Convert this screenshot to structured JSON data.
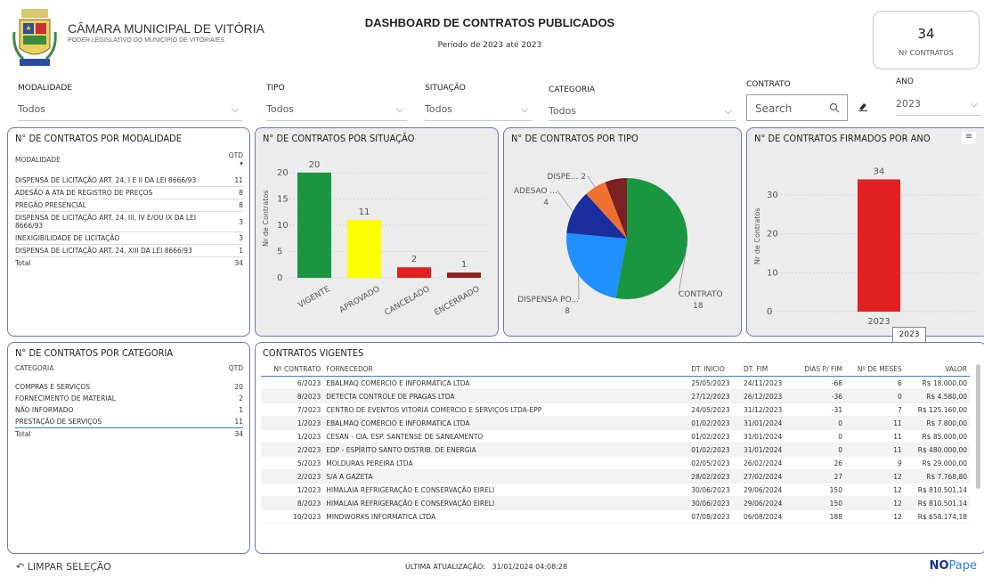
{
  "header": {
    "org_name": "CÂMARA MUNICIPAL DE VITÓRIA",
    "org_sub": "PODER LEGISLATIVO DO MUNICÍPIO DE VITÓRIA/ES",
    "title": "DASHBOARD DE CONTRATOS PUBLICADOS",
    "period": "Período de 2023 até 2023",
    "count_value": "34",
    "count_label": "Nº CONTRATOS"
  },
  "filters": {
    "modalidade": {
      "label": "MODALIDADE",
      "value": "Todos"
    },
    "tipo": {
      "label": "TIPO",
      "value": "Todos"
    },
    "situacao": {
      "label": "SITUAÇÃO",
      "value": "Todos"
    },
    "categoria": {
      "label": "CATEGORIA",
      "value": "Todos"
    },
    "contrato": {
      "label": "CONTRATO",
      "placeholder": "Search"
    },
    "ano": {
      "label": "ANO",
      "value": "2023"
    }
  },
  "modalidade_panel": {
    "title": "N° DE CONTRATOS POR MODALIDADE",
    "col1": "MODALIDADE",
    "col2": "QTD",
    "rows": [
      {
        "name": "DISPENSA DE LICITAÇÃO ART. 24, I E II DA LEI 8666/93",
        "qtd": "11"
      },
      {
        "name": "ADESÃO A ATA DE REGISTRO DE PREÇOS",
        "qtd": "8"
      },
      {
        "name": "PREGÃO PRESENCIAL",
        "qtd": "8"
      },
      {
        "name": "DISPENSA DE LICITAÇÃO ART. 24, III, IV E/OU IX DA LEI 8666/93",
        "qtd": "3"
      },
      {
        "name": "INEXIGIBILIDADE DE LICITAÇÃO",
        "qtd": "3"
      },
      {
        "name": "DISPENSA DE LICITAÇÃO ART. 24, XIII DA LEI 8666/93",
        "qtd": "1"
      }
    ],
    "total_label": "Total",
    "total_value": "34"
  },
  "situacao_panel": {
    "title": "N° DE CONTRATOS POR SITUAÇÃO"
  },
  "tipo_panel": {
    "title": "N° DE CONTRATOS POR TIPO"
  },
  "ano_panel": {
    "title": "N° DE CONTRATOS FIRMADOS POR ANO",
    "tooltip": "2023"
  },
  "categoria_panel": {
    "title": "N° DE CONTRATOS POR CATEGORIA",
    "col1": "CATEGORIA",
    "col2": "QTD",
    "rows": [
      {
        "name": "COMPRAS E SERVIÇOS",
        "qtd": "20"
      },
      {
        "name": "FORNECIMENTO DE MATERIAL",
        "qtd": "2"
      },
      {
        "name": "NÃO INFORMADO",
        "qtd": "1"
      },
      {
        "name": "PRESTAÇÃO DE SERVIÇOS",
        "qtd": "11"
      }
    ],
    "total_label": "Total",
    "total_value": "34"
  },
  "vigentes": {
    "title": "CONTRATOS VIGENTES",
    "columns": [
      "Nº CONTRATO",
      "FORNECEDOR",
      "DT. INICIO",
      "DT. FIM",
      "DIAS P/ FIM",
      "Nº DE MESES",
      "VALOR"
    ],
    "rows": [
      [
        "6/2023",
        "EBALMAQ COMÉRCIO E INFORMÁTICA LTDA",
        "25/05/2023",
        "24/11/2023",
        "-68",
        "6",
        "R$ 18.000,00"
      ],
      [
        "8/2023",
        "DETECTA CONTROLE DE PRAGAS LTDA",
        "27/12/2023",
        "26/12/2023",
        "-36",
        "0",
        "R$ 4.580,00"
      ],
      [
        "7/2023",
        "CENTRO DE EVENTOS VITORIA COMERCIO E SERVIÇOS LTDA-EPP",
        "24/05/2023",
        "31/12/2023",
        "-31",
        "7",
        "R$ 125.160,00"
      ],
      [
        "1/2023",
        "EBALMAQ COMÉRCIO E INFORMATICA LTDA",
        "01/02/2023",
        "31/01/2024",
        "0",
        "11",
        "R$ 7.800,00"
      ],
      [
        "1/2023",
        "CESAN - CIA. ESP. SANTENSE DE SANEAMENTO",
        "01/02/2023",
        "31/01/2024",
        "0",
        "11",
        "R$ 85.000,00"
      ],
      [
        "2/2023",
        "EDP - ESPÍRITO SANTO DISTRIB. DE ENERGIA",
        "01/02/2023",
        "31/01/2024",
        "0",
        "11",
        "R$ 480.000,00"
      ],
      [
        "5/2023",
        "MOLDURAS PEREIRA LTDA",
        "02/05/2023",
        "26/02/2024",
        "26",
        "9",
        "R$ 29.000,00"
      ],
      [
        "2/2023",
        "S/A A GAZETA",
        "28/02/2023",
        "27/02/2024",
        "27",
        "12",
        "R$ 7.768,80"
      ],
      [
        "1/2023",
        "HIMALAIA REFRIGERAÇÃO E CONSERVAÇÃO EIRELI",
        "30/06/2023",
        "29/06/2024",
        "150",
        "12",
        "R$ 810.501,14"
      ],
      [
        "8/2023",
        "HIMALAIA REFRIGERAÇÃO E CONSERVAÇÃO EIRELI",
        "30/06/2023",
        "29/06/2024",
        "150",
        "12",
        "R$ 810.501,14"
      ],
      [
        "10/2023",
        "MINDWORKS INFORMATICA LTDA",
        "07/08/2023",
        "06/08/2024",
        "188",
        "12",
        "R$ 658.174,18"
      ]
    ]
  },
  "footer": {
    "clear_label": "LIMPAR SELEÇÃO",
    "update_label": "ÚLTIMA ATUALIZAÇÃO:",
    "update_value": "31/01/2024 04:08:28",
    "brand_a": "NO",
    "brand_b": "Pape"
  },
  "colors": {
    "panel_border": "#6b77b8",
    "vigente": "#1a9641",
    "aprovado": "#ffff00",
    "cancelado": "#e02020",
    "encerrado": "#8b2020",
    "ano_bar": "#e02020",
    "pie_contrato": "#1a9641",
    "pie_dispensa": "#1e90ff",
    "pie_adesao": "#1a2e9e",
    "pie_dispe": "#f07030",
    "pie_other": "#7a2020"
  },
  "chart_data": [
    {
      "type": "bar",
      "title": "N° DE CONTRATOS POR SITUAÇÃO",
      "categories": [
        "VIGENTE",
        "APROVADO",
        "CANCELADO",
        "ENCERRADO"
      ],
      "values": [
        20,
        11,
        2,
        1
      ],
      "ylabel": "Nr de Contratos",
      "yticks": [
        0,
        5,
        10,
        15,
        20
      ],
      "ylim": [
        0,
        22
      ]
    },
    {
      "type": "pie",
      "title": "N° DE CONTRATOS POR TIPO",
      "slices": [
        {
          "label": "CONTRATO",
          "value": 18
        },
        {
          "label": "DISPENSA PO...",
          "value": 8
        },
        {
          "label": "ADESAO ...",
          "value": 4
        },
        {
          "label": "DISPE...",
          "value": 2
        },
        {
          "label": "",
          "value": 2
        }
      ]
    },
    {
      "type": "bar",
      "title": "N° DE CONTRATOS FIRMADOS POR ANO",
      "categories": [
        "2023"
      ],
      "values": [
        34
      ],
      "ylabel": "Nr de Contratos",
      "yticks": [
        0,
        10,
        20,
        30
      ],
      "ylim": [
        0,
        38
      ]
    }
  ]
}
